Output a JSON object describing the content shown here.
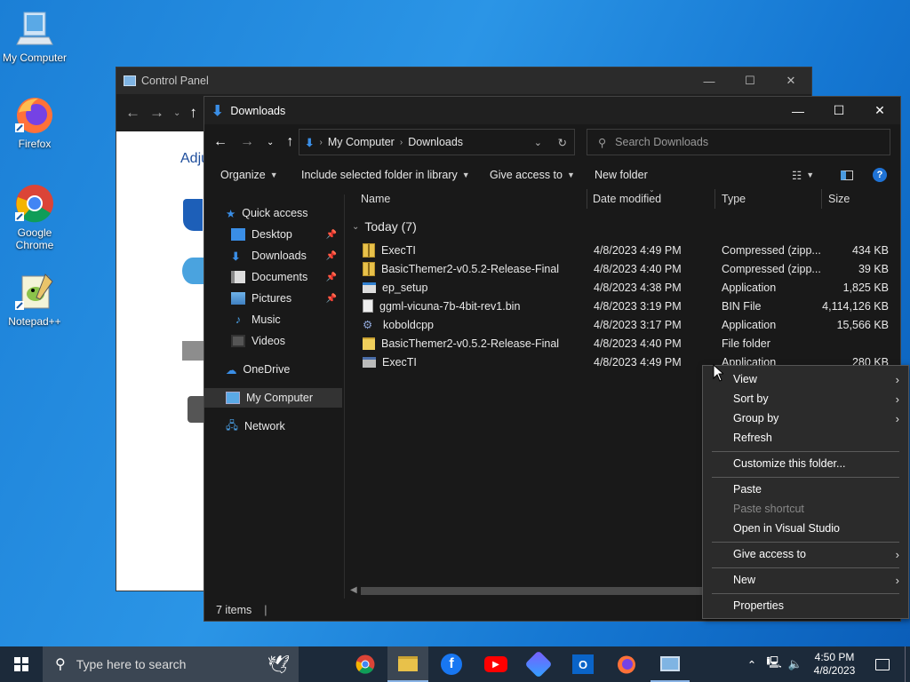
{
  "desktop": {
    "icons": [
      {
        "label": "My Computer",
        "name": "my-computer-icon"
      },
      {
        "label": "Firefox",
        "name": "firefox-icon"
      },
      {
        "label": "Google Chrome",
        "name": "chrome-icon"
      },
      {
        "label": "Notepad++",
        "name": "notepadpp-icon"
      }
    ]
  },
  "control_panel": {
    "title": "Control Panel",
    "partial_text": "Adju"
  },
  "explorer": {
    "title": "Downloads",
    "breadcrumb": [
      "My Computer",
      "Downloads"
    ],
    "search_placeholder": "Search Downloads",
    "commands": {
      "organize": "Organize",
      "include": "Include selected folder in library",
      "give_access": "Give access to",
      "new_folder": "New folder"
    },
    "nav": {
      "quick_access": "Quick access",
      "items": [
        "Desktop",
        "Downloads",
        "Documents",
        "Pictures",
        "Music",
        "Videos"
      ],
      "onedrive": "OneDrive",
      "my_computer": "My Computer",
      "network": "Network"
    },
    "columns": {
      "name": "Name",
      "date": "Date modified",
      "type": "Type",
      "size": "Size"
    },
    "group": "Today (7)",
    "files": [
      {
        "name": "ExecTI",
        "date": "4/8/2023 4:49 PM",
        "type": "Compressed (zipp...",
        "size": "434 KB",
        "icon": "zip"
      },
      {
        "name": "BasicThemer2-v0.5.2-Release-Final",
        "date": "4/8/2023 4:40 PM",
        "type": "Compressed (zipp...",
        "size": "39 KB",
        "icon": "zip"
      },
      {
        "name": "ep_setup",
        "date": "4/8/2023 4:38 PM",
        "type": "Application",
        "size": "1,825 KB",
        "icon": "app"
      },
      {
        "name": "ggml-vicuna-7b-4bit-rev1.bin",
        "date": "4/8/2023 3:19 PM",
        "type": "BIN File",
        "size": "4,114,126 KB",
        "icon": "file"
      },
      {
        "name": "koboldcpp",
        "date": "4/8/2023 3:17 PM",
        "type": "Application",
        "size": "15,566 KB",
        "icon": "gear"
      },
      {
        "name": "BasicThemer2-v0.5.2-Release-Final",
        "date": "4/8/2023 4:40 PM",
        "type": "File folder",
        "size": "",
        "icon": "folder"
      },
      {
        "name": "ExecTI",
        "date": "4/8/2023 4:49 PM",
        "type": "Application",
        "size": "280 KB",
        "icon": "app2"
      }
    ],
    "status": "7 items"
  },
  "context_menu": {
    "view": "View",
    "sort_by": "Sort by",
    "group_by": "Group by",
    "refresh": "Refresh",
    "customize": "Customize this folder...",
    "paste": "Paste",
    "paste_shortcut": "Paste shortcut",
    "open_vs": "Open in Visual Studio",
    "give_access": "Give access to",
    "new": "New",
    "properties": "Properties"
  },
  "taskbar": {
    "search_placeholder": "Type here to search",
    "time": "4:50 PM",
    "date": "4/8/2023"
  },
  "colors": {
    "accent": "#0078d7",
    "folder": "#e8c14a",
    "dark_bg": "#191919"
  }
}
